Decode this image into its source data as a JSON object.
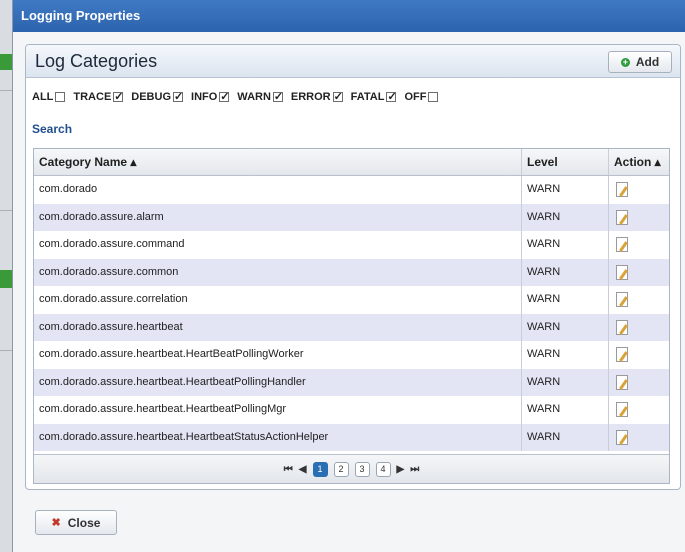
{
  "window": {
    "title": "Logging Properties"
  },
  "panel": {
    "title": "Log Categories",
    "add_label": "Add"
  },
  "filters": [
    {
      "label": "ALL",
      "checked": false
    },
    {
      "label": "TRACE",
      "checked": true
    },
    {
      "label": "DEBUG",
      "checked": true
    },
    {
      "label": "INFO",
      "checked": true
    },
    {
      "label": "WARN",
      "checked": true
    },
    {
      "label": "ERROR",
      "checked": true
    },
    {
      "label": "FATAL",
      "checked": true
    },
    {
      "label": "OFF",
      "checked": false
    }
  ],
  "search_label": "Search",
  "table": {
    "headers": {
      "name": "Category Name ▴",
      "level": "Level",
      "action": "Action ▴"
    },
    "rows": [
      {
        "name": "com.dorado",
        "level": "WARN"
      },
      {
        "name": "com.dorado.assure.alarm",
        "level": "WARN"
      },
      {
        "name": "com.dorado.assure.command",
        "level": "WARN"
      },
      {
        "name": "com.dorado.assure.common",
        "level": "WARN"
      },
      {
        "name": "com.dorado.assure.correlation",
        "level": "WARN"
      },
      {
        "name": "com.dorado.assure.heartbeat",
        "level": "WARN"
      },
      {
        "name": "com.dorado.assure.heartbeat.HeartBeatPollingWorker",
        "level": "WARN"
      },
      {
        "name": "com.dorado.assure.heartbeat.HeartbeatPollingHandler",
        "level": "WARN"
      },
      {
        "name": "com.dorado.assure.heartbeat.HeartbeatPollingMgr",
        "level": "WARN"
      },
      {
        "name": "com.dorado.assure.heartbeat.HeartbeatStatusActionHelper",
        "level": "WARN"
      }
    ]
  },
  "pager": {
    "pages": [
      "1",
      "2",
      "3",
      "4"
    ],
    "current": "1",
    "first": "⏮",
    "prev": "◀",
    "next": "▶",
    "last": "⏭"
  },
  "close_label": "Close"
}
